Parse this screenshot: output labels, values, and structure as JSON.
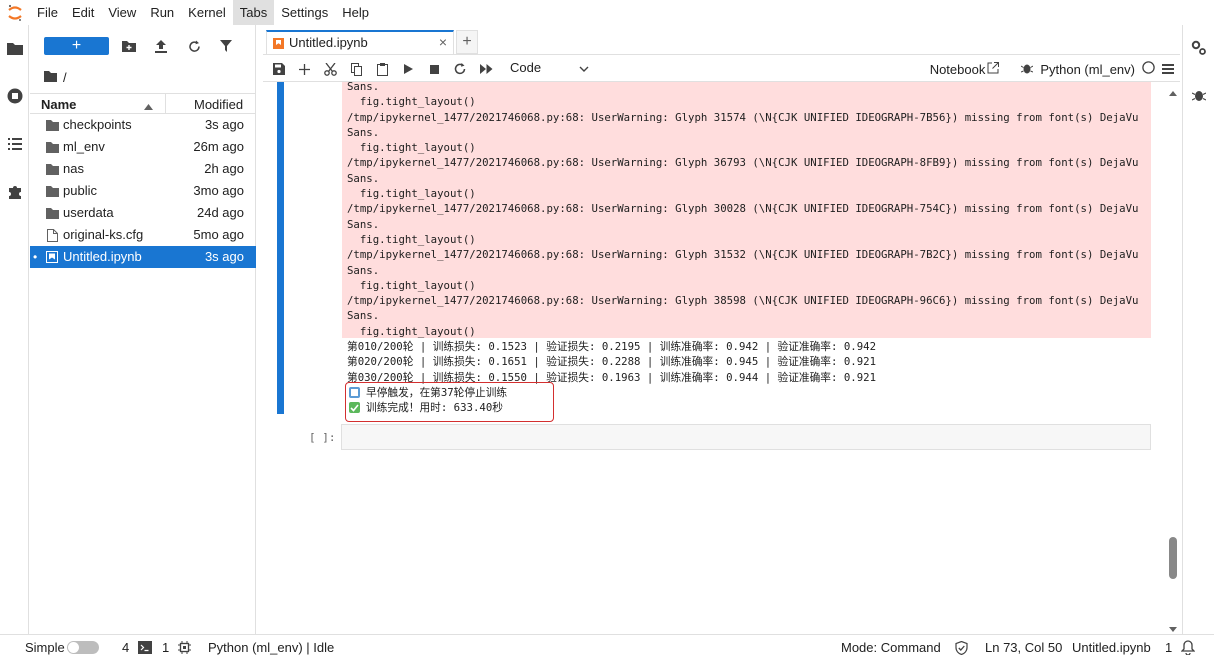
{
  "menubar": {
    "items": [
      {
        "label": "File",
        "active": false
      },
      {
        "label": "Edit",
        "active": false
      },
      {
        "label": "View",
        "active": false
      },
      {
        "label": "Run",
        "active": false
      },
      {
        "label": "Kernel",
        "active": false
      },
      {
        "label": "Tabs",
        "active": true
      },
      {
        "label": "Settings",
        "active": false
      },
      {
        "label": "Help",
        "active": false
      }
    ]
  },
  "filebrowser": {
    "new_label": "+",
    "breadcrumb": "/",
    "header": {
      "name": "Name",
      "modified": "Modified"
    },
    "files": [
      {
        "name": "checkpoints",
        "modified": "3s ago",
        "icon": "folder-icon",
        "selected": false
      },
      {
        "name": "ml_env",
        "modified": "26m ago",
        "icon": "folder-icon",
        "selected": false
      },
      {
        "name": "nas",
        "modified": "2h ago",
        "icon": "folder-icon",
        "selected": false
      },
      {
        "name": "public",
        "modified": "3mo ago",
        "icon": "folder-icon",
        "selected": false
      },
      {
        "name": "userdata",
        "modified": "24d ago",
        "icon": "folder-icon",
        "selected": false
      },
      {
        "name": "original-ks.cfg",
        "modified": "5mo ago",
        "icon": "file-icon",
        "selected": false
      },
      {
        "name": "Untitled.ipynb",
        "modified": "3s ago",
        "icon": "notebook-icon",
        "selected": true
      }
    ]
  },
  "tab": {
    "title": "Untitled.ipynb",
    "close": "×",
    "add": "+"
  },
  "toolbar": {
    "cell_type": "Code",
    "notebook_label": "Notebook",
    "kernel_name": "Python (ml_env)"
  },
  "output": {
    "stderr_lines": [
      "Sans.",
      "  fig.tight_layout()",
      "/tmp/ipykernel_1477/2021746068.py:68: UserWarning: Glyph 31574 (\\N{CJK UNIFIED IDEOGRAPH-7B56}) missing from font(s) DejaVu",
      "Sans.",
      "  fig.tight_layout()",
      "/tmp/ipykernel_1477/2021746068.py:68: UserWarning: Glyph 36793 (\\N{CJK UNIFIED IDEOGRAPH-8FB9}) missing from font(s) DejaVu",
      "Sans.",
      "  fig.tight_layout()",
      "/tmp/ipykernel_1477/2021746068.py:68: UserWarning: Glyph 30028 (\\N{CJK UNIFIED IDEOGRAPH-754C}) missing from font(s) DejaVu",
      "Sans.",
      "  fig.tight_layout()",
      "/tmp/ipykernel_1477/2021746068.py:68: UserWarning: Glyph 31532 (\\N{CJK UNIFIED IDEOGRAPH-7B2C}) missing from font(s) DejaVu",
      "Sans.",
      "  fig.tight_layout()",
      "/tmp/ipykernel_1477/2021746068.py:68: UserWarning: Glyph 38598 (\\N{CJK UNIFIED IDEOGRAPH-96C6}) missing from font(s) DejaVu",
      "Sans.",
      "  fig.tight_layout()"
    ],
    "stdout_lines": [
      "第010/200轮 | 训练损失: 0.1523 | 验证损失: 0.2195 | 训练准确率: 0.942 | 验证准确率: 0.942",
      "第020/200轮 | 训练损失: 0.1651 | 验证损失: 0.2288 | 训练准确率: 0.945 | 验证准确率: 0.921",
      "第030/200轮 | 训练损失: 0.1550 | 验证损失: 0.1963 | 训练准确率: 0.944 | 验证准确率: 0.921"
    ],
    "early_stop": "早停触发，在第37轮停止训练",
    "done": "训练完成！用时: 633.40秒"
  },
  "next_cell": {
    "prompt": "[ ]:"
  },
  "statusbar": {
    "mode_label": "Simple",
    "terminals": "4",
    "kernels": "1",
    "kernel_status": "Python (ml_env) | Idle",
    "mode": "Mode: Command",
    "cursor": "Ln 73, Col 50",
    "file": "Untitled.ipynb",
    "notifications": "1"
  },
  "colors": {
    "accent": "#1976d2",
    "stderr_bg": "#ffdddd",
    "highlight": "#d32f2f"
  }
}
